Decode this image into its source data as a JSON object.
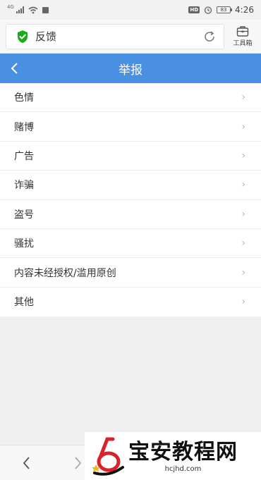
{
  "status_bar": {
    "network_label": "4G",
    "battery_level": "83",
    "time": "4:26",
    "hd_label": "HD"
  },
  "address_bar": {
    "url_text": "反馈",
    "toolbox_label": "工具箱",
    "security_color": "#1aad19"
  },
  "header": {
    "title": "举报",
    "accent_color": "#4a90e2"
  },
  "report_items": [
    {
      "label": "色情"
    },
    {
      "label": "赌博"
    },
    {
      "label": "广告"
    },
    {
      "label": "诈骗"
    },
    {
      "label": "盗号"
    },
    {
      "label": "骚扰"
    },
    {
      "label": "内容未经授权/滥用原创"
    },
    {
      "label": "其他"
    }
  ],
  "bottom_nav": {
    "back_icon": "chevron-left-icon",
    "forward_icon": "chevron-right-icon"
  },
  "watermark": {
    "title": "宝安教程网",
    "url": "hcjhd.com"
  }
}
